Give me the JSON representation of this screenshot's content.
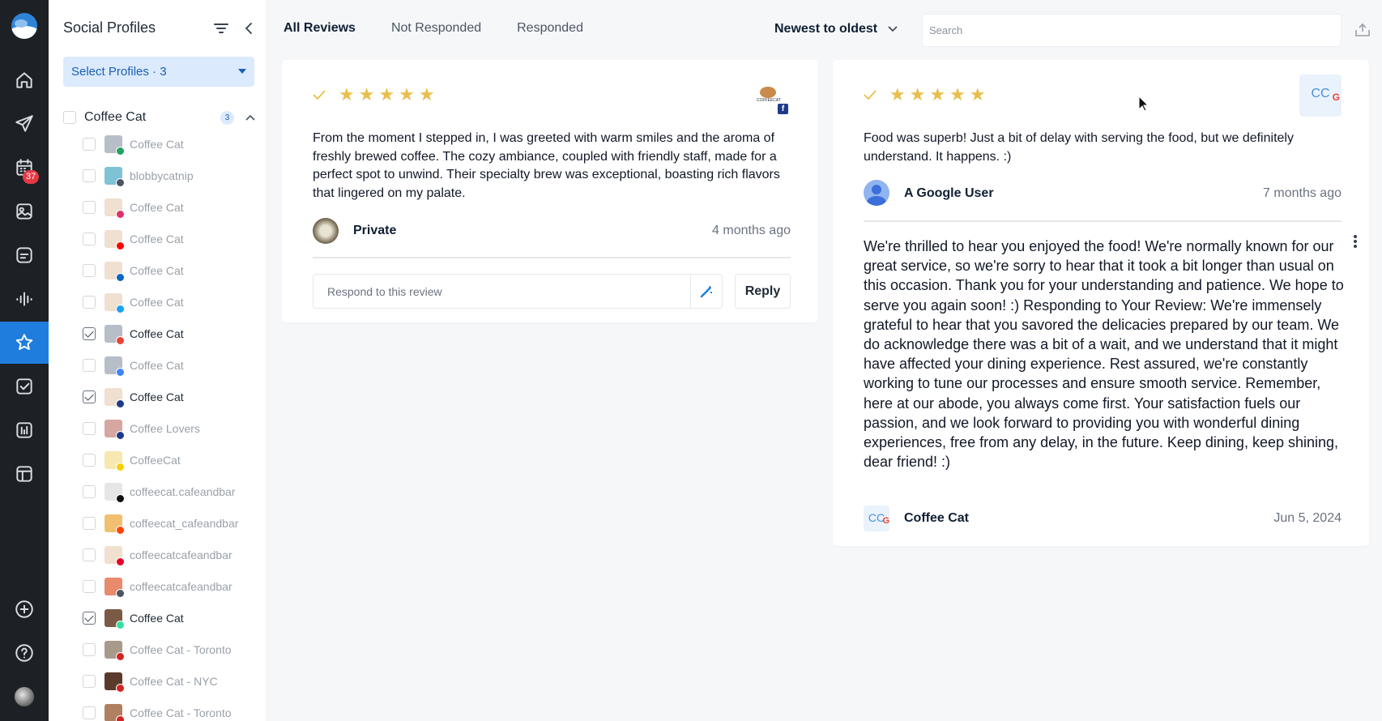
{
  "nav": {
    "badge_count": "37",
    "items": [
      "home-icon",
      "send-icon",
      "calendar-icon",
      "media-icon",
      "inbox-icon",
      "listening-icon",
      "reviews-icon",
      "tasks-icon",
      "analytics-icon",
      "layout-icon",
      "add-icon",
      "help-icon"
    ],
    "accent": "#1e7ddd"
  },
  "profiles_panel": {
    "title": "Social Profiles",
    "select_label": "Select Profiles · 3",
    "group": {
      "name": "Coffee Cat",
      "count": "3"
    },
    "items": [
      {
        "name": "Coffee Cat",
        "selected": false,
        "network": "star"
      },
      {
        "name": "blobbycatnip",
        "selected": false,
        "network": "threads"
      },
      {
        "name": "Coffee Cat",
        "selected": false,
        "network": "instagram"
      },
      {
        "name": "Coffee Cat",
        "selected": false,
        "network": "youtube"
      },
      {
        "name": "Coffee Cat",
        "selected": false,
        "network": "linkedin"
      },
      {
        "name": "Coffee Cat",
        "selected": false,
        "network": "twitter"
      },
      {
        "name": "Coffee Cat",
        "selected": true,
        "network": "google"
      },
      {
        "name": "Coffee Cat",
        "selected": false,
        "network": "gmb"
      },
      {
        "name": "Coffee Cat",
        "selected": true,
        "network": "facebook"
      },
      {
        "name": "Coffee Lovers",
        "selected": false,
        "network": "facebook"
      },
      {
        "name": "CoffeeCat",
        "selected": false,
        "network": "snapchat"
      },
      {
        "name": "coffeecat.cafeandbar",
        "selected": false,
        "network": "tiktok"
      },
      {
        "name": "coffeecat_cafeandbar",
        "selected": false,
        "network": "reddit"
      },
      {
        "name": "coffeecatcafeandbar",
        "selected": false,
        "network": "pinterest"
      },
      {
        "name": "coffeecatcafeandbar",
        "selected": false,
        "network": "threads"
      },
      {
        "name": "Coffee Cat",
        "selected": true,
        "network": "tripadvisor"
      },
      {
        "name": "Coffee Cat - Toronto",
        "selected": false,
        "network": "yelp"
      },
      {
        "name": "Coffee Cat - NYC",
        "selected": false,
        "network": "yelp"
      },
      {
        "name": "Coffee Cat - Toronto",
        "selected": false,
        "network": "yelp"
      }
    ]
  },
  "toolbar": {
    "tabs": [
      "All Reviews",
      "Not Responded",
      "Responded"
    ],
    "sort_label": "Newest to oldest",
    "search_placeholder": "Search"
  },
  "reviews": [
    {
      "rating": 5,
      "stars": "★★★★★",
      "text": "From the moment I stepped in, I was greeted with warm smiles and the aroma of freshly brewed coffee. The cozy ambiance, coupled with friendly staff, made for a perfect spot to unwind. Their specialty brew was exceptional, boasting rich flavors that lingered on my palate.",
      "reviewer": "Private",
      "time": "4 months ago",
      "network": "facebook",
      "profile_logo_text": "COFFEECAT",
      "respond_placeholder": "Respond to this review",
      "reply_label": "Reply"
    },
    {
      "rating": 5,
      "stars": "★★★★★",
      "text": "Food was superb! Just a bit of delay with serving the food, but we definitely understand. It happens. :)",
      "reviewer": "A Google User",
      "time": "7 months ago",
      "network": "google",
      "profile_initials": "CC",
      "response": {
        "text": "We're thrilled to hear you enjoyed the food! We're normally known for our great service, so we're sorry to hear that it took a bit longer than usual on this occasion. Thank you for your understanding and patience. We hope to serve you again soon! :) Responding to Your Review: We're immensely grateful to hear that you savored the delicacies prepared by our team. We do acknowledge there was a bit of a wait, and we understand that it might have affected your dining experience. Rest assured, we're constantly working to tune our processes and ensure smooth service. Remember, here at our abode, you always come first. Your satisfaction fuels our passion, and we look forward to providing you with wonderful dining experiences, free from any delay, in the future. Keep dining, keep shining, dear friend! :)",
        "author": "Coffee Cat",
        "author_initials": "CC",
        "date": "Jun 5, 2024"
      }
    }
  ]
}
